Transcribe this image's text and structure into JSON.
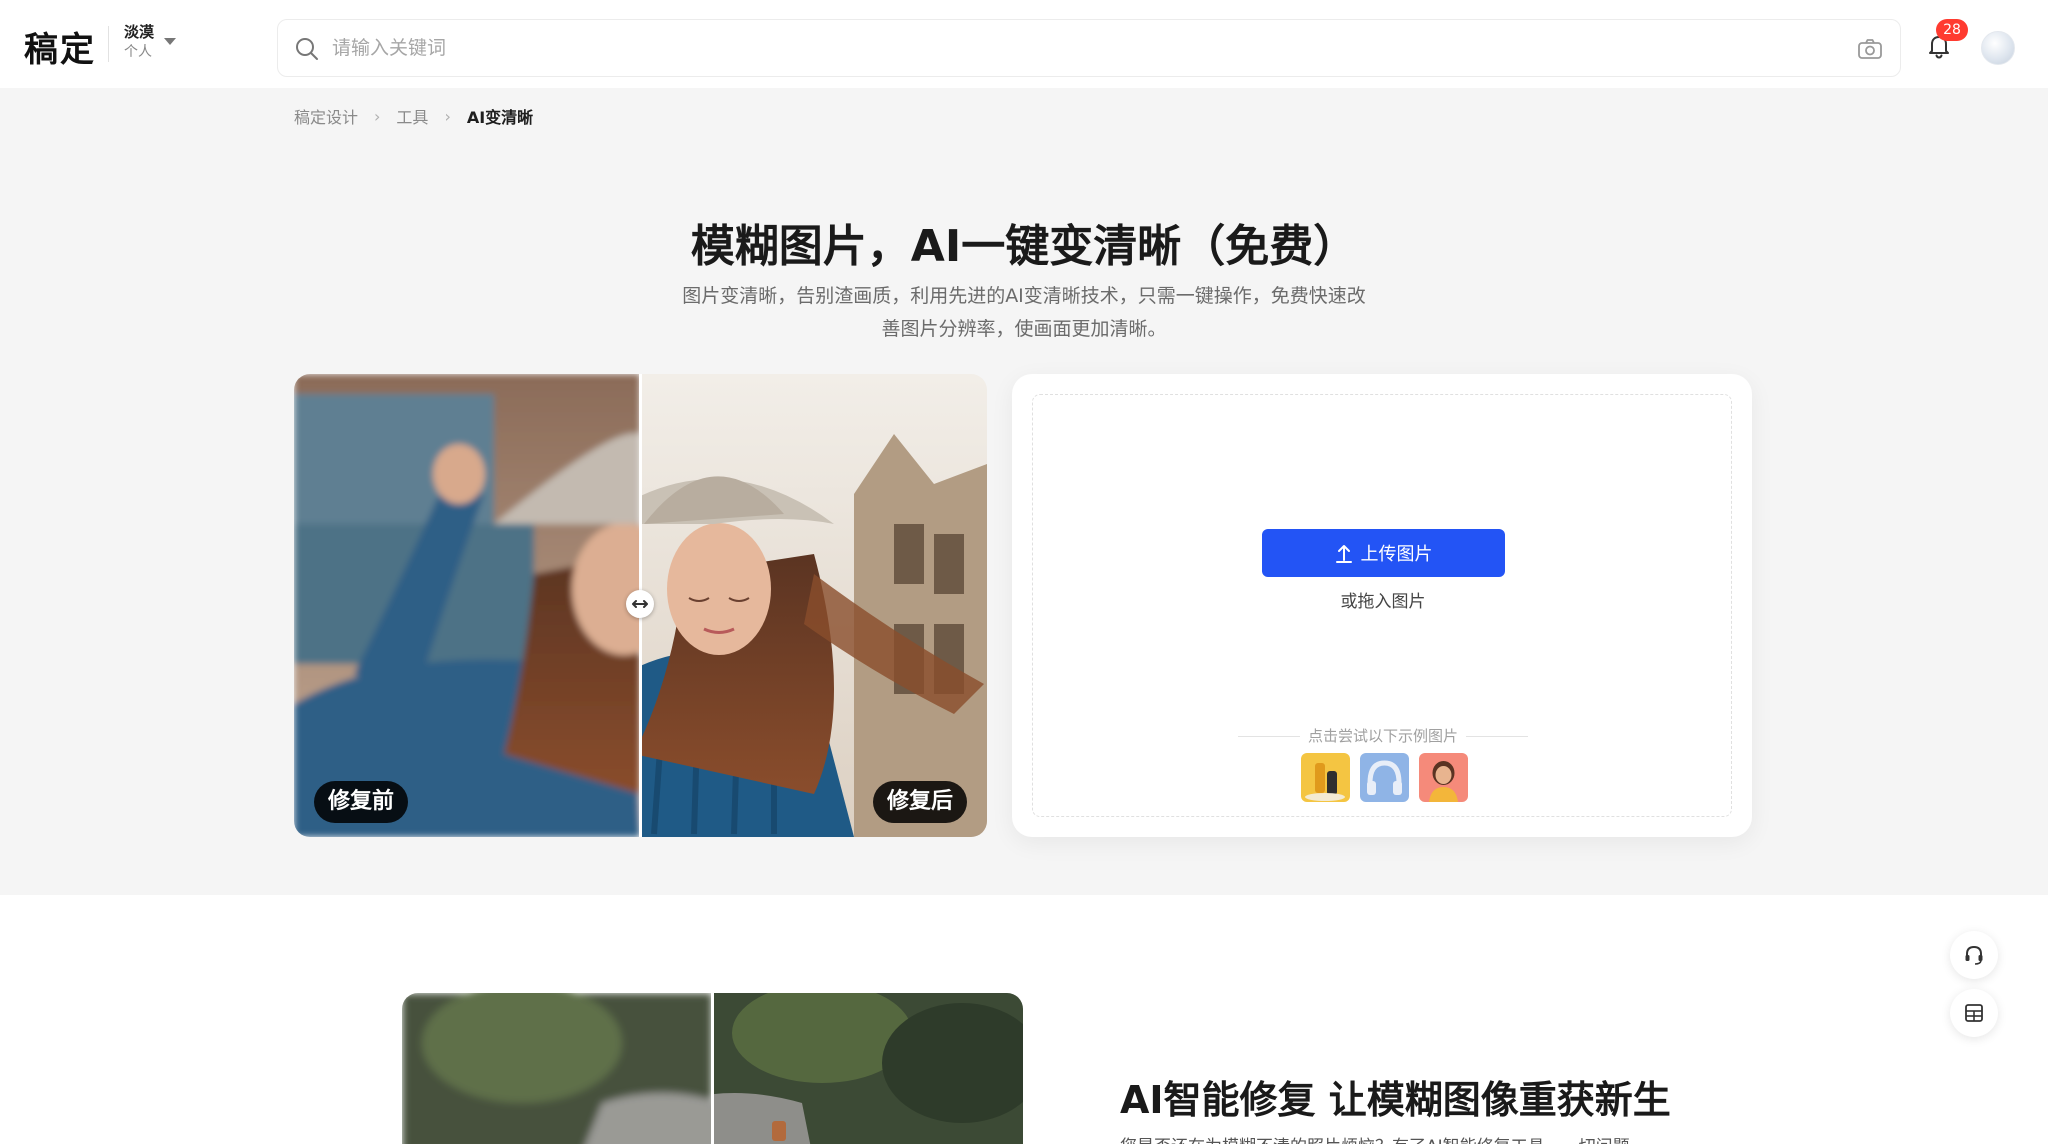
{
  "header": {
    "logo": "稿定",
    "team": {
      "name": "淡漠",
      "type": "个人"
    },
    "search": {
      "placeholder": "请输入关键词"
    },
    "notifications": {
      "count": "28"
    }
  },
  "breadcrumb": {
    "items": [
      "稿定设计",
      "工具"
    ],
    "current": "AI变清晰"
  },
  "hero": {
    "title": "模糊图片，AI一键变清晰（免费）",
    "description": "图片变清晰，告别渣画质，利用先进的AI变清晰技术，只需一键操作，免费快速改善图片分辨率，使画面更加清晰。"
  },
  "compare": {
    "before_label": "修复前",
    "after_label": "修复后",
    "split": 0.5
  },
  "upload": {
    "button_label": "上传图片",
    "drag_hint": "或拖入图片",
    "sample_title": "点击尝试以下示例图片",
    "samples": [
      "cosmetics-sample",
      "headphones-sample",
      "portrait-sample"
    ]
  },
  "feature": {
    "title": "AI智能修复 让模糊图像重获新生",
    "description": "您是否还在为模糊不清的照片烦恼？有了AI智能修复工具，一切问题"
  },
  "colors": {
    "primary": "#2354f5",
    "badge": "#ff3b30",
    "page_bg": "#f5f5f5"
  },
  "icons": {
    "search": "search-icon",
    "camera": "camera-icon",
    "bell": "bell-icon",
    "upload": "upload-arrow-icon",
    "service": "headset-icon",
    "table": "table-icon"
  }
}
